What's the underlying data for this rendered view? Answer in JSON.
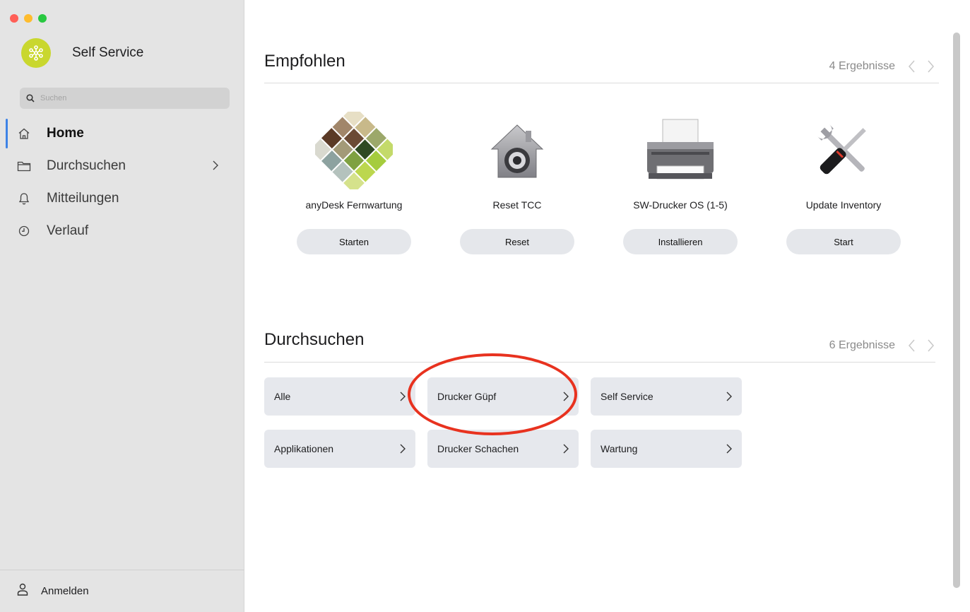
{
  "window": {
    "controls": {
      "close_color": "#ff5f57",
      "minimize_color": "#febc2e",
      "zoom_color": "#28c840"
    }
  },
  "sidebar": {
    "app_name": "Self Service",
    "search": {
      "placeholder": "Suchen",
      "value": ""
    },
    "items": [
      {
        "label": "Home",
        "icon": "home-icon",
        "active": true
      },
      {
        "label": "Durchsuchen",
        "icon": "folder-icon",
        "has_chevron": true
      },
      {
        "label": "Mitteilungen",
        "icon": "bell-icon"
      },
      {
        "label": "Verlauf",
        "icon": "clock-icon"
      }
    ],
    "footer": {
      "label": "Anmelden",
      "icon": "person-icon"
    }
  },
  "featured": {
    "title": "Empfohlen",
    "count": "4 Ergebnisse",
    "items": [
      {
        "name": "anyDesk Fernwartung",
        "button": "Starten",
        "icon": "anydesk-icon"
      },
      {
        "name": "Reset TCC",
        "button": "Reset",
        "icon": "security-house-icon"
      },
      {
        "name": "SW-Drucker OS (1-5)",
        "button": "Installieren",
        "icon": "printer-icon"
      },
      {
        "name": "Update Inventory",
        "button": "Start",
        "icon": "tools-icon"
      }
    ]
  },
  "browse": {
    "title": "Durchsuchen",
    "count": "6 Ergebnisse",
    "categories": [
      {
        "label": "Alle"
      },
      {
        "label": "Drucker Güpf",
        "highlighted": true
      },
      {
        "label": "Self Service"
      },
      {
        "label": "Applikationen"
      },
      {
        "label": "Drucker Schachen"
      },
      {
        "label": "Wartung"
      }
    ]
  },
  "colors": {
    "accent": "#3e83e6",
    "highlight_ring": "#e8321f",
    "brand_logo": "#c9d72e"
  }
}
